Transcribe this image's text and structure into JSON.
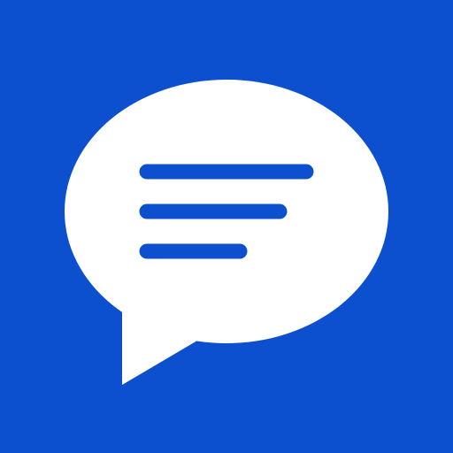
{
  "icon": {
    "name": "chat-bubble-icon",
    "background_color": "#0C50CF",
    "bubble_color": "#FFFFFF",
    "line_color": "#0C50CF",
    "text_lines": 3
  }
}
